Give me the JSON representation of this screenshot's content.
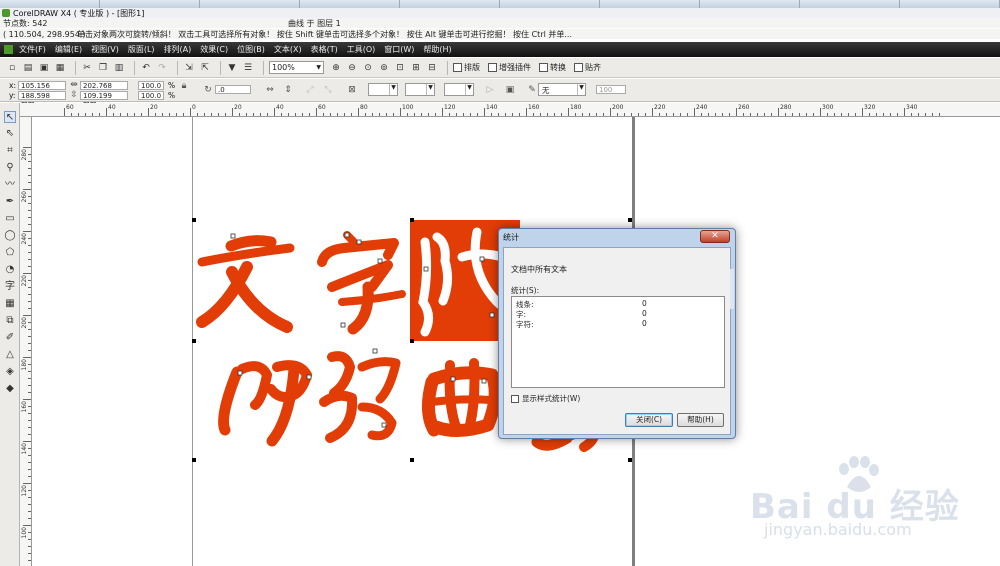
{
  "window": {
    "title": "CorelDRAW X4 ( 专业版 ) - [图形1]"
  },
  "status": {
    "node_count": "节点数: 542",
    "object_info": "曲线 于 图层 1",
    "cursor_coords": "( 110.504, 298.954 )",
    "hint": "单击对象两次可旋转/倾斜！ 双击工具可选择所有对象！ 按住 Shift 键单击可选择多个对象！ 按住 Alt 键单击可进行挖掘！ 按住 Ctrl 并单..."
  },
  "menu": [
    "文件(F)",
    "编辑(E)",
    "视图(V)",
    "版面(L)",
    "排列(A)",
    "效果(C)",
    "位图(B)",
    "文本(X)",
    "表格(T)",
    "工具(O)",
    "窗口(W)",
    "帮助(H)"
  ],
  "toolbar": {
    "zoom": "100%",
    "plugins": [
      "排版",
      "增强插件",
      "转换",
      "贴齐"
    ]
  },
  "properties": {
    "x": "105.156 mm",
    "y": "188.598 mm",
    "width": "202.768 mm",
    "height": "109.199 mm",
    "scale_x": "100.0",
    "scale_y": "100.0",
    "pct": "%",
    "rotation": ".0",
    "outline": "无",
    "outline_width": "100"
  },
  "labels": {
    "x": "x:",
    "y": "y:"
  },
  "ruler": {
    "h_labels": [
      "60",
      "40",
      "20",
      "0",
      "20",
      "40",
      "60",
      "80",
      "100",
      "120",
      "140",
      "160",
      "180",
      "200",
      "220",
      "240",
      "260",
      "280",
      "300",
      "320",
      "340"
    ],
    "v_labels": [
      "280",
      "260",
      "240",
      "220",
      "200",
      "180",
      "160",
      "140",
      "120",
      "100"
    ]
  },
  "dialog": {
    "title": "统计",
    "close_glyph": "✕",
    "heading": "文档中所有文本",
    "stats_label": "统计(S):",
    "rows": [
      {
        "label": "线条:",
        "value": "0"
      },
      {
        "label": "字:",
        "value": "0"
      },
      {
        "label": "字符:",
        "value": "0"
      }
    ],
    "show_style_stats": "显示样式统计(W)",
    "close_button": "关闭(C)",
    "help_button": "帮助(H)"
  },
  "colors": {
    "art_red": "#e23d06",
    "menubar": "#1a1a1a"
  },
  "watermark": {
    "brand": "Bai du 经验",
    "url": "jingyan.baidu.com"
  }
}
